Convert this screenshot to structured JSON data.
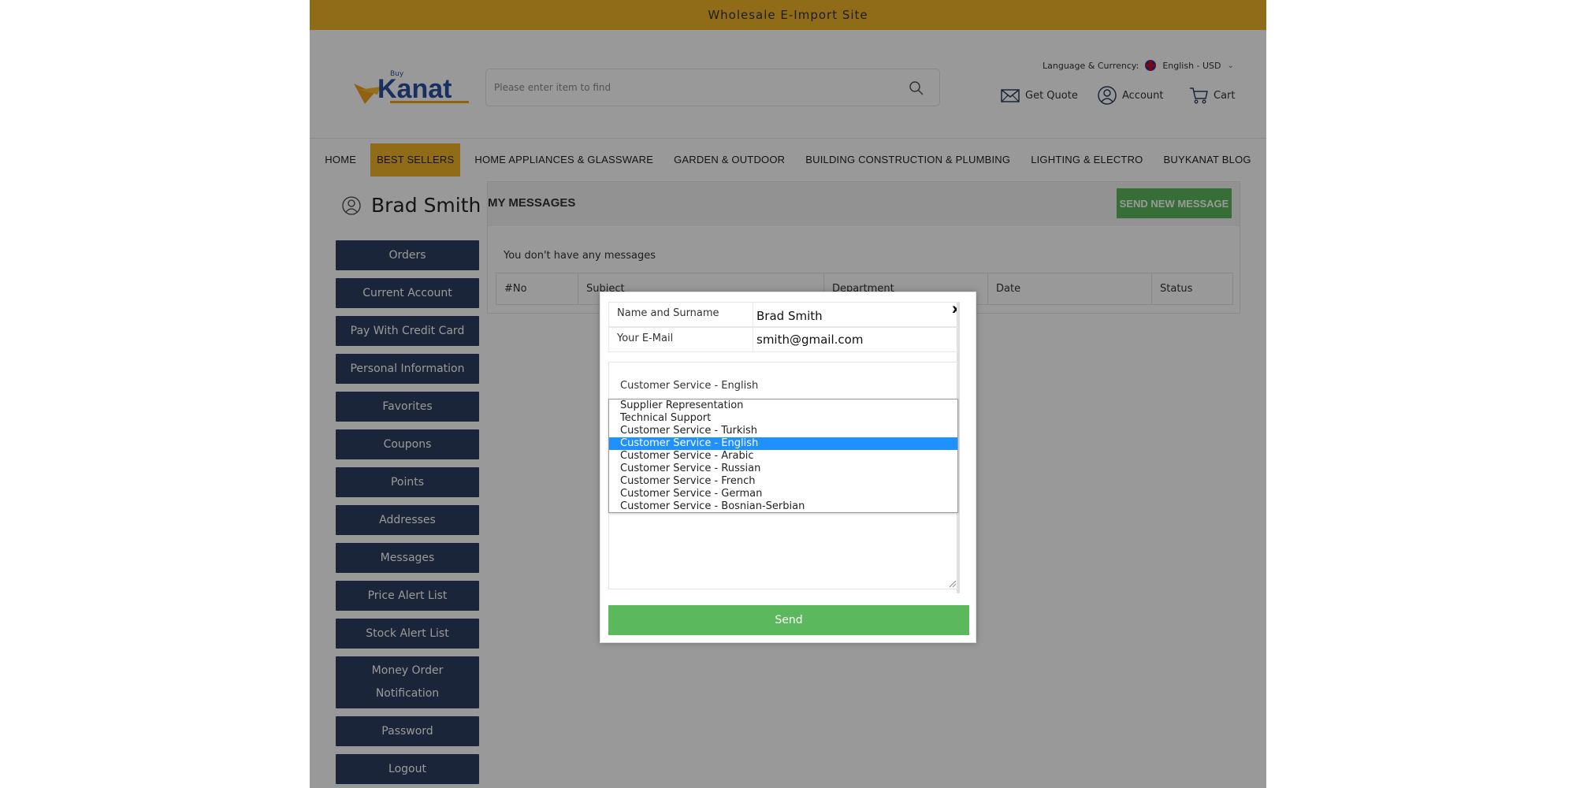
{
  "topbar": {
    "text": "Wholesale E-Import Site"
  },
  "header": {
    "logo_alt": "Kanat",
    "search_placeholder": "Please enter item to find",
    "language_label": "Language & Currency:",
    "language_value": "English - USD",
    "get_quote": "Get Quote",
    "account": "Account",
    "cart": "Cart"
  },
  "nav": {
    "items": [
      {
        "label": "HOME"
      },
      {
        "label": "BEST SELLERS"
      },
      {
        "label": "HOME APPLIANCES & GLASSWARE"
      },
      {
        "label": "GARDEN & OUTDOOR"
      },
      {
        "label": "BUILDING CONSTRUCTION & PLUMBING"
      },
      {
        "label": "LIGHTING & ELECTRO"
      },
      {
        "label": "BUYKANAT BLOG"
      }
    ]
  },
  "user": {
    "name": "Brad Smith"
  },
  "sidebar": {
    "items": [
      {
        "label": "Orders"
      },
      {
        "label": "Current Account"
      },
      {
        "label": "Pay With Credit Card"
      },
      {
        "label": "Personal Information"
      },
      {
        "label": "Favorites"
      },
      {
        "label": "Coupons"
      },
      {
        "label": "Points"
      },
      {
        "label": "Addresses"
      },
      {
        "label": "Messages"
      },
      {
        "label": "Price Alert List"
      },
      {
        "label": "Stock Alert List"
      },
      {
        "label": "Money Order Notification"
      },
      {
        "label": "Password"
      },
      {
        "label": "Logout"
      }
    ]
  },
  "content": {
    "title": "MY MESSAGES",
    "send_new": "SEND NEW MESSAGE",
    "empty_text": "You don't have any messages",
    "columns": [
      "#No",
      "Subject",
      "Department",
      "Date",
      "Status"
    ]
  },
  "modal": {
    "close": "x",
    "name_label": "Name and Surname",
    "name_value": "Brad Smith",
    "email_label": "Your E-Mail",
    "email_value": "smith@gmail.com",
    "department_selected": "Customer Service - English",
    "department_options": [
      "Supplier Representation",
      "Technical Support",
      "Customer Service - Turkish",
      "Customer Service - English",
      "Customer Service - Arabic",
      "Customer Service - Russian",
      "Customer Service - French",
      "Customer Service - German",
      "Customer Service - Bosnian-Serbian"
    ],
    "send": "Send"
  },
  "colors": {
    "accent_yellow": "#f0b429",
    "sidebar_navy": "#2c3e5f",
    "send_green": "#5cb85c",
    "select_blue": "#1e90ff"
  }
}
